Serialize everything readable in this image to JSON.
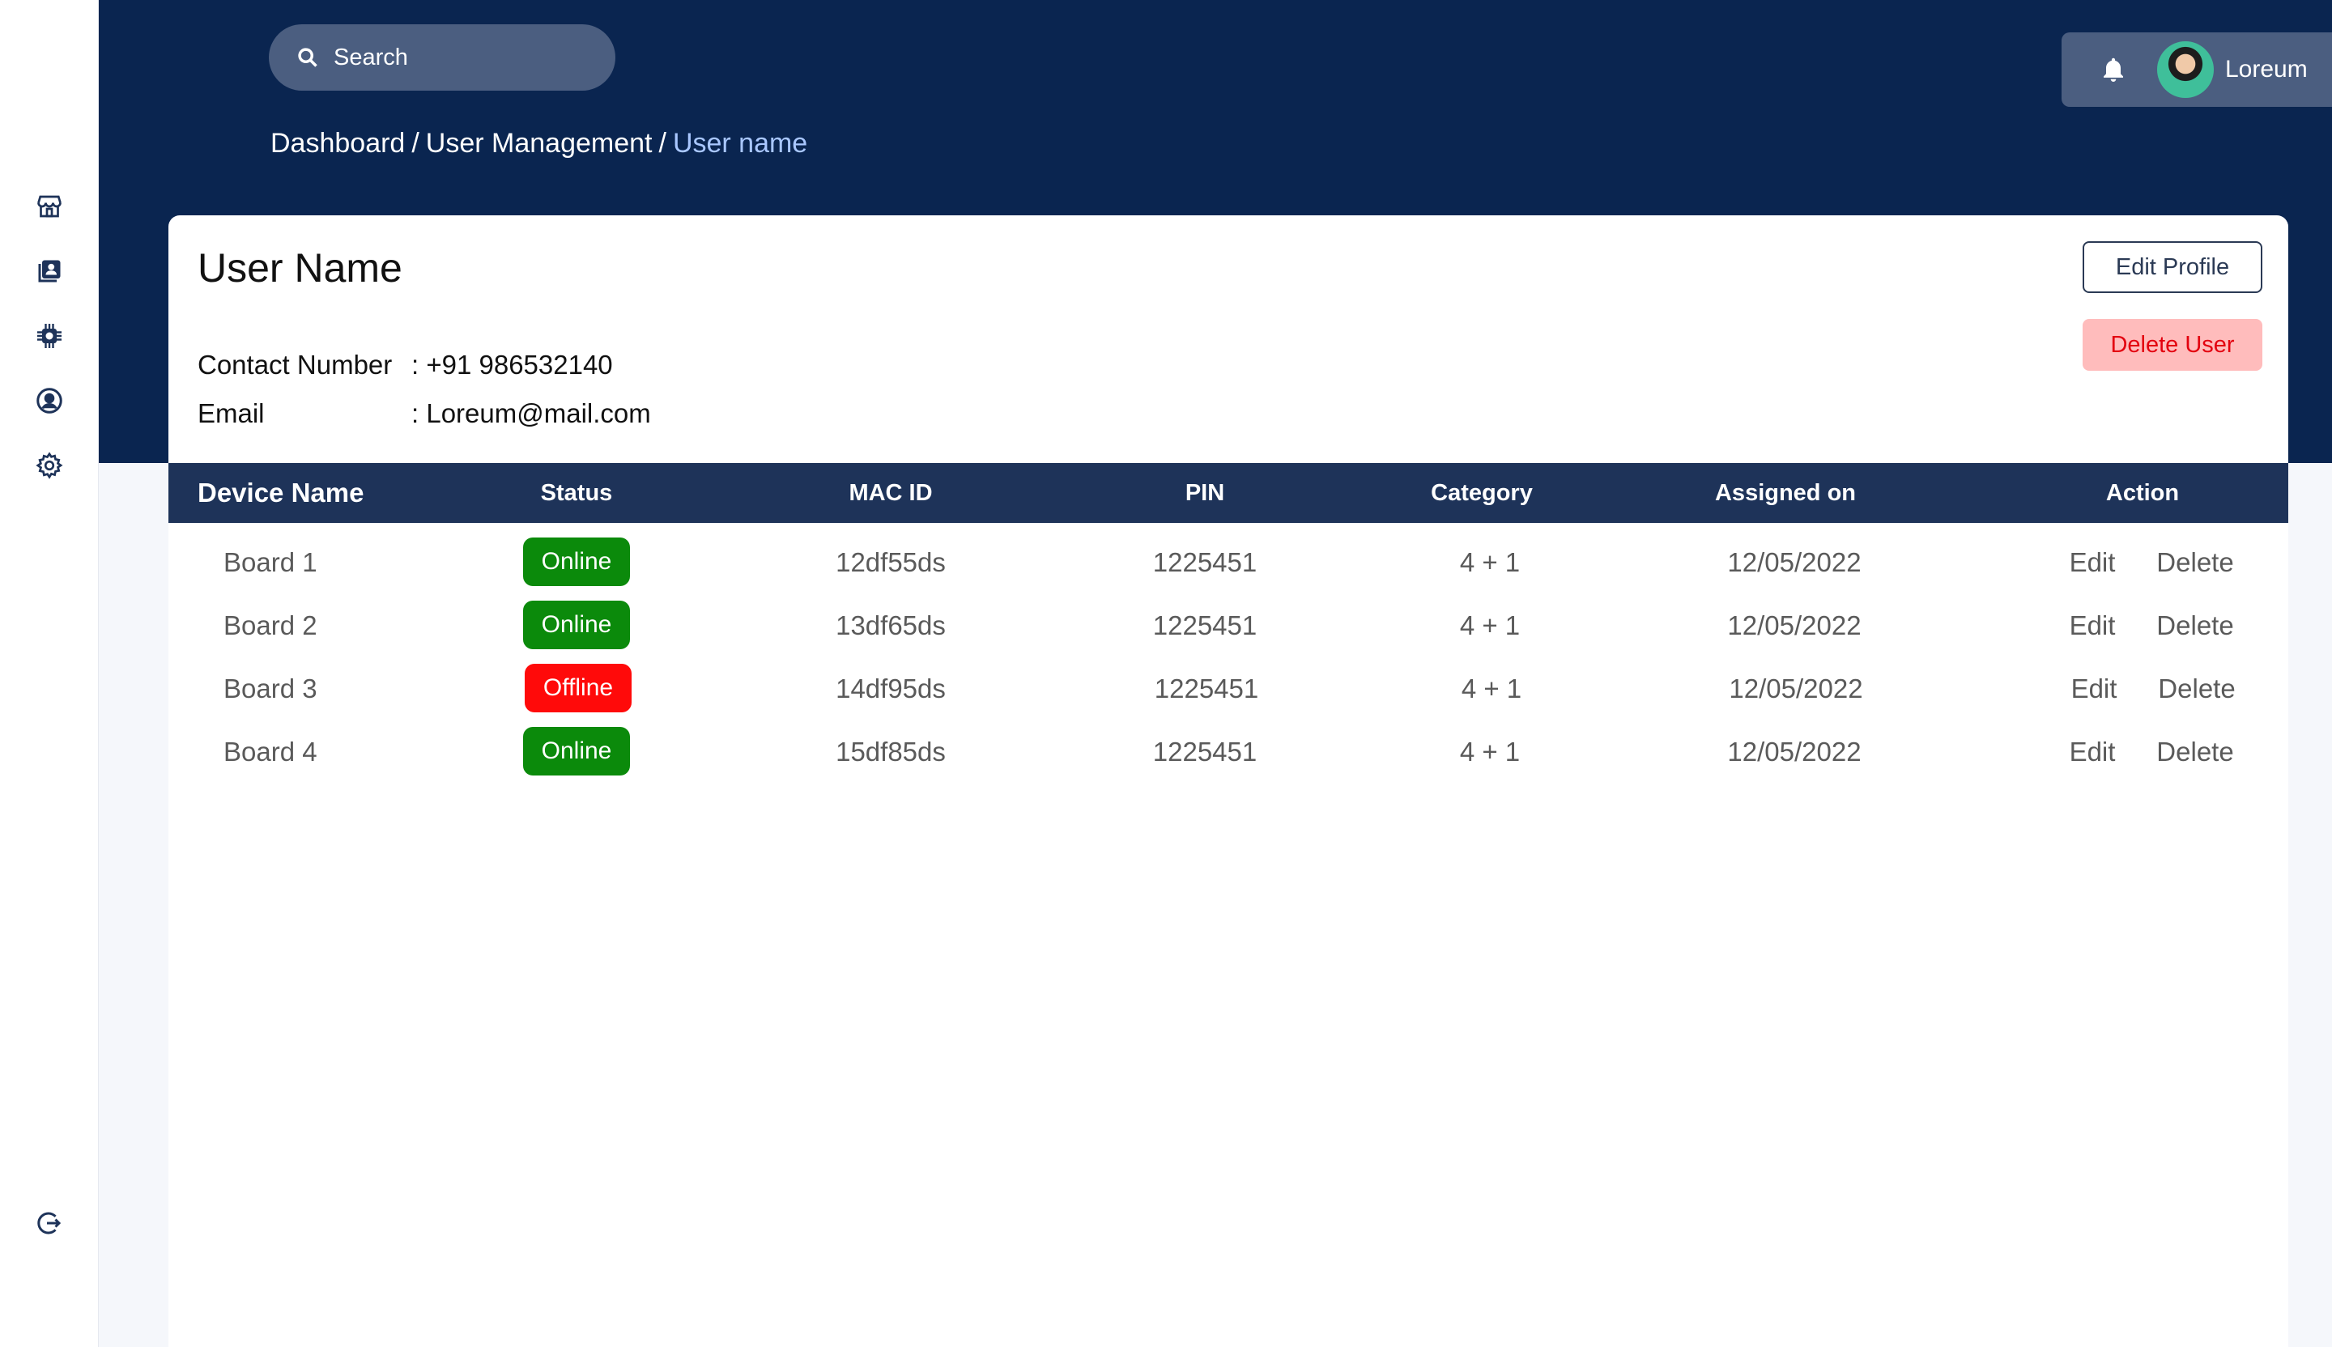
{
  "search": {
    "placeholder": "Search"
  },
  "breadcrumb": {
    "items": [
      "Dashboard",
      "User Management"
    ],
    "current": "User name",
    "separator": "/"
  },
  "user": {
    "name": "Loreum"
  },
  "sidebar": {
    "icons": [
      "store-icon",
      "contacts-icon",
      "chip-icon",
      "account-icon",
      "settings-icon"
    ],
    "bottom_icon": "logout-icon"
  },
  "profile": {
    "title": "User Name",
    "contact_label": "Contact Number",
    "contact_value": ": +91 986532140",
    "email_label": "Email",
    "email_value": ": Loreum@mail.com",
    "edit_label": "Edit Profile",
    "delete_label": "Delete User"
  },
  "table": {
    "columns": [
      "Device Name",
      "Status",
      "MAC ID",
      "PIN",
      "Category",
      "Assigned on",
      "Action"
    ],
    "rows": [
      {
        "device": "Board 1",
        "status": "Online",
        "mac": "12df55ds",
        "pin": "1225451",
        "category": "4 + 1",
        "assigned": "12/05/2022",
        "edit": "Edit",
        "delete": "Delete"
      },
      {
        "device": "Board 2",
        "status": "Online",
        "mac": "13df65ds",
        "pin": "1225451",
        "category": "4 + 1",
        "assigned": "12/05/2022",
        "edit": "Edit",
        "delete": "Delete"
      },
      {
        "device": "Board 3",
        "status": "Offline",
        "mac": "14df95ds",
        "pin": "1225451",
        "category": "4 + 1",
        "assigned": "12/05/2022",
        "edit": "Edit",
        "delete": "Delete"
      },
      {
        "device": "Board 4",
        "status": "Online",
        "mac": "15df85ds",
        "pin": "1225451",
        "category": "4 + 1",
        "assigned": "12/05/2022",
        "edit": "Edit",
        "delete": "Delete"
      }
    ]
  },
  "colors": {
    "header_bg": "#0a2550",
    "table_header_bg": "#1e3359",
    "online": "#0b8a0b",
    "offline": "#ff0a0a",
    "breadcrumb_current": "#a9c7ff",
    "delete_bg": "#ffbcbc",
    "delete_text": "#e3000f"
  }
}
